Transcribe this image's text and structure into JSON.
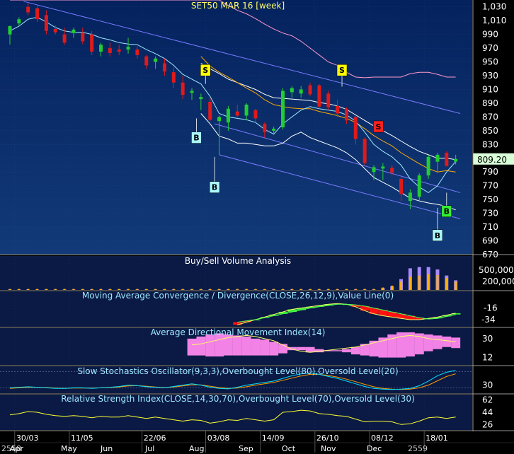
{
  "colors": {
    "bg_top": "#062a6a",
    "bg_bottom": "#0d2f66",
    "panel_bg": "#0a1a44",
    "grid": "#4a5a8a",
    "up": "#22cc33",
    "down": "#e01a1a",
    "ema_fast": "#ffffff",
    "ema_mid": "#ffaa00",
    "ema_slow": "#ff99cc",
    "channel": "#7b7bff",
    "macd_line": "#ffff66",
    "macd_hist_pos": "#33ee33",
    "macd_hist_neg": "#ff1111",
    "adx_fill": "#ff88ee",
    "stoch_k": "#00e0ff",
    "stoch_d": "#ff9900",
    "rsi": "#ffff33"
  },
  "chart_data": [
    {
      "type": "candlestick",
      "title": "SET50 MAR 16  [week]",
      "ylim": [
        670,
        1040
      ],
      "y_ticks": [
        1030,
        1010,
        990,
        970,
        950,
        930,
        910,
        890,
        870,
        850,
        830,
        810,
        790,
        770,
        750,
        730,
        710,
        690,
        670
      ],
      "last_price": "809.20",
      "x_date_labels": [
        "30/03",
        "11/05",
        "22/06",
        "03/08",
        "14/09",
        "26/10",
        "08/12",
        "18/01"
      ],
      "x_month_labels": [
        "2558",
        "Apr",
        "May",
        "Jun",
        "Jul",
        "Aug",
        "Sep",
        "Oct",
        "Nov",
        "Dec",
        "2559"
      ],
      "candles": [
        {
          "o": 990,
          "h": 1003,
          "l": 975,
          "c": 1002
        },
        {
          "o": 1006,
          "h": 1015,
          "l": 1002,
          "c": 1012
        },
        {
          "o": 1030,
          "h": 1035,
          "l": 1018,
          "c": 1022
        },
        {
          "o": 1028,
          "h": 1033,
          "l": 1008,
          "c": 1012
        },
        {
          "o": 1018,
          "h": 1025,
          "l": 990,
          "c": 995
        },
        {
          "o": 998,
          "h": 1003,
          "l": 990,
          "c": 993
        },
        {
          "o": 990,
          "h": 1000,
          "l": 975,
          "c": 978
        },
        {
          "o": 992,
          "h": 1000,
          "l": 985,
          "c": 997
        },
        {
          "o": 992,
          "h": 1000,
          "l": 976,
          "c": 980
        },
        {
          "o": 990,
          "h": 995,
          "l": 960,
          "c": 965
        },
        {
          "o": 965,
          "h": 978,
          "l": 958,
          "c": 975
        },
        {
          "o": 970,
          "h": 978,
          "l": 958,
          "c": 963
        },
        {
          "o": 968,
          "h": 975,
          "l": 960,
          "c": 965
        },
        {
          "o": 968,
          "h": 985,
          "l": 962,
          "c": 972
        },
        {
          "o": 968,
          "h": 972,
          "l": 955,
          "c": 960
        },
        {
          "o": 958,
          "h": 960,
          "l": 940,
          "c": 945
        },
        {
          "o": 950,
          "h": 958,
          "l": 940,
          "c": 955
        },
        {
          "o": 948,
          "h": 955,
          "l": 930,
          "c": 936
        },
        {
          "o": 935,
          "h": 942,
          "l": 912,
          "c": 920
        },
        {
          "o": 920,
          "h": 930,
          "l": 896,
          "c": 902
        },
        {
          "o": 905,
          "h": 912,
          "l": 895,
          "c": 908
        },
        {
          "o": 896,
          "h": 904,
          "l": 880,
          "c": 899
        },
        {
          "o": 892,
          "h": 898,
          "l": 864,
          "c": 866
        },
        {
          "o": 864,
          "h": 872,
          "l": 815,
          "c": 870
        },
        {
          "o": 862,
          "h": 886,
          "l": 850,
          "c": 882
        },
        {
          "o": 878,
          "h": 888,
          "l": 870,
          "c": 872
        },
        {
          "o": 872,
          "h": 890,
          "l": 865,
          "c": 888
        },
        {
          "o": 880,
          "h": 882,
          "l": 862,
          "c": 868
        },
        {
          "o": 860,
          "h": 862,
          "l": 840,
          "c": 848
        },
        {
          "o": 850,
          "h": 856,
          "l": 844,
          "c": 853
        },
        {
          "o": 855,
          "h": 912,
          "l": 852,
          "c": 908
        },
        {
          "o": 906,
          "h": 915,
          "l": 898,
          "c": 912
        },
        {
          "o": 904,
          "h": 915,
          "l": 898,
          "c": 910
        },
        {
          "o": 916,
          "h": 920,
          "l": 900,
          "c": 903
        },
        {
          "o": 916,
          "h": 918,
          "l": 882,
          "c": 885
        },
        {
          "o": 904,
          "h": 908,
          "l": 880,
          "c": 884
        },
        {
          "o": 886,
          "h": 895,
          "l": 870,
          "c": 875
        },
        {
          "o": 882,
          "h": 884,
          "l": 860,
          "c": 865
        },
        {
          "o": 870,
          "h": 872,
          "l": 830,
          "c": 838
        },
        {
          "o": 838,
          "h": 840,
          "l": 800,
          "c": 803
        },
        {
          "o": 790,
          "h": 800,
          "l": 778,
          "c": 797
        },
        {
          "o": 795,
          "h": 803,
          "l": 778,
          "c": 798
        },
        {
          "o": 796,
          "h": 800,
          "l": 785,
          "c": 789
        },
        {
          "o": 780,
          "h": 783,
          "l": 748,
          "c": 758
        },
        {
          "o": 748,
          "h": 765,
          "l": 736,
          "c": 760
        },
        {
          "o": 754,
          "h": 788,
          "l": 748,
          "c": 785
        },
        {
          "o": 785,
          "h": 815,
          "l": 780,
          "c": 812
        },
        {
          "o": 805,
          "h": 818,
          "l": 790,
          "c": 815
        },
        {
          "o": 818,
          "h": 820,
          "l": 798,
          "c": 799
        },
        {
          "o": 805,
          "h": 815,
          "l": 801,
          "c": 809
        }
      ],
      "indicators": {
        "ema_fast": [
          995,
          1002,
          1012,
          1015,
          1008,
          1000,
          995,
          993,
          993,
          990,
          985,
          982,
          978,
          976,
          975,
          968,
          962,
          955,
          945,
          932,
          925,
          918,
          900,
          875,
          870,
          868,
          866,
          862,
          852,
          845,
          860,
          870,
          880,
          885,
          882,
          880,
          878,
          873,
          864,
          848,
          830,
          820,
          812,
          800,
          780,
          768,
          760,
          770,
          790,
          805
        ],
        "ema_mid": [
          null,
          null,
          null,
          null,
          null,
          null,
          null,
          null,
          null,
          null,
          null,
          null,
          null,
          null,
          null,
          null,
          null,
          null,
          null,
          null,
          null,
          958,
          944,
          935,
          928,
          920,
          912,
          905,
          895,
          888,
          885,
          883,
          882,
          882,
          878,
          875,
          872,
          868,
          862,
          853,
          843,
          835,
          828,
          818,
          810,
          802,
          795,
          790,
          792,
          790
        ],
        "ema_slow": [
          null,
          null,
          null,
          null,
          null,
          null,
          null,
          null,
          null,
          null,
          null,
          null,
          null,
          null,
          null,
          null,
          null,
          null,
          null,
          null,
          null,
          948,
          940,
          933,
          925,
          920,
          915,
          910,
          903,
          898,
          897,
          896,
          895,
          894,
          891,
          889,
          886,
          881,
          873,
          865,
          857,
          850,
          843,
          835,
          827,
          820,
          815,
          810,
          810,
          808
        ],
        "bb_upper": [
          1040,
          1040,
          1040,
          1040,
          1040,
          1040,
          1040,
          1040,
          1040,
          1040,
          1040,
          1040,
          1040,
          1040,
          1040,
          1040,
          1040,
          1040,
          1040,
          1040,
          1040,
          1040,
          1040,
          1040,
          1032,
          1025,
          1020,
          1013,
          1005,
          998,
          992,
          988,
          980,
          970,
          960,
          950,
          945,
          935,
          928,
          927,
          928,
          928,
          928,
          928,
          933,
          935,
          935,
          932,
          928,
          928
        ],
        "bb_lower": [
          null,
          null,
          null,
          null,
          null,
          null,
          null,
          null,
          null,
          null,
          null,
          null,
          null,
          null,
          null,
          null,
          null,
          null,
          null,
          null,
          null,
          875,
          860,
          842,
          838,
          832,
          832,
          830,
          828,
          828,
          832,
          842,
          848,
          840,
          835,
          830,
          825,
          818,
          808,
          795,
          782,
          775,
          768,
          760,
          752,
          748,
          745,
          743,
          740,
          735
        ]
      },
      "channel_lines": [
        {
          "name": "upper",
          "from": {
            "i": 1.5,
            "v": 1038
          },
          "to": {
            "i": 49.5,
            "v": 875
          }
        },
        {
          "name": "mid",
          "from": {
            "i": 22.5,
            "v": 860
          },
          "to": {
            "i": 49.5,
            "v": 760
          }
        },
        {
          "name": "lower",
          "from": {
            "i": 23.0,
            "v": 815
          },
          "to": {
            "i": 49.5,
            "v": 722
          }
        }
      ],
      "signals": [
        {
          "label": "S",
          "i": 21.5,
          "v": 938,
          "color": "#ffff00",
          "text_color": "#000000"
        },
        {
          "label": "S",
          "i": 36.5,
          "v": 938,
          "color": "#ffff00",
          "text_color": "#000000"
        },
        {
          "label": "S",
          "i": 40.5,
          "v": 856,
          "color": "#ff2020",
          "text_color": "#000000"
        },
        {
          "label": "B",
          "i": 20.5,
          "v": 840,
          "color": "#aaf8ff",
          "text_color": "#000000"
        },
        {
          "label": "B",
          "i": 22.5,
          "v": 768,
          "color": "#aaf8ff",
          "text_color": "#000000"
        },
        {
          "label": "B",
          "i": 48.0,
          "v": 733,
          "color": "#33ee33",
          "text_color": "#000000"
        },
        {
          "label": "B",
          "i": 47.0,
          "v": 698,
          "color": "#aaf8ff",
          "text_color": "#000000"
        }
      ]
    },
    {
      "type": "bar",
      "title": "Buy/Sell Volume Analysis",
      "y_ticks": [
        "500,000",
        "200,000"
      ],
      "note": "volume bars mostly near zero until the last eight weeks",
      "buy": [
        0.04,
        0.04,
        0.04,
        0.04,
        0.04,
        0.04,
        0.04,
        0.04,
        0.04,
        0.04,
        0.04,
        0.04,
        0.04,
        0.04,
        0.04,
        0.04,
        0.04,
        0.04,
        0.04,
        0.04,
        0.04,
        0.04,
        0.04,
        0.04,
        0.04,
        0.04,
        0.04,
        0.04,
        0.04,
        0.04,
        0.04,
        0.04,
        0.04,
        0.04,
        0.04,
        0.04,
        0.04,
        0.04,
        0.04,
        0.04,
        0.04,
        0.1,
        0.18,
        0.35,
        0.55,
        0.6,
        0.65,
        0.62,
        0.5,
        0.35
      ],
      "sell": [
        0.02,
        0.02,
        0.02,
        0.02,
        0.02,
        0.02,
        0.02,
        0.02,
        0.02,
        0.02,
        0.02,
        0.02,
        0.02,
        0.02,
        0.02,
        0.02,
        0.02,
        0.02,
        0.02,
        0.02,
        0.02,
        0.02,
        0.02,
        0.02,
        0.02,
        0.02,
        0.02,
        0.02,
        0.02,
        0.02,
        0.02,
        0.02,
        0.02,
        0.02,
        0.02,
        0.02,
        0.02,
        0.02,
        0.02,
        0.02,
        0.02,
        0.08,
        0.15,
        0.45,
        0.9,
        0.95,
        0.95,
        0.85,
        0.6,
        0.4
      ]
    },
    {
      "type": "line",
      "title": "Moving Average Convergence / Divergence(CLOSE,26,12,9),Value Line(0)",
      "y_ticks": [
        "-16",
        "-34"
      ],
      "ylim": [
        -45,
        10
      ],
      "macd": [
        null,
        null,
        null,
        null,
        null,
        null,
        null,
        null,
        null,
        null,
        null,
        null,
        null,
        null,
        null,
        null,
        null,
        null,
        null,
        null,
        null,
        null,
        null,
        null,
        null,
        -42,
        -38,
        -34,
        -30,
        -26,
        -22,
        -18,
        -16,
        -14,
        -12,
        -10,
        -9,
        -10,
        -14,
        -20,
        -25,
        -28,
        -30,
        -32,
        -34,
        -34,
        -32,
        -30,
        -27,
        -24
      ],
      "signal": [
        null,
        null,
        null,
        null,
        null,
        null,
        null,
        null,
        null,
        null,
        null,
        null,
        null,
        null,
        null,
        null,
        null,
        null,
        null,
        null,
        null,
        null,
        null,
        null,
        null,
        -38,
        -36,
        -34,
        -31,
        -28,
        -25,
        -22,
        -19,
        -16,
        -14,
        -12,
        -10,
        -10,
        -11,
        -13,
        -16,
        -19,
        -22,
        -25,
        -28,
        -31,
        -33,
        -32,
        -29,
        -26
      ]
    },
    {
      "type": "area",
      "title": "Average Directional Movement Index(14)",
      "y_ticks": [
        "30",
        "12"
      ],
      "ylim": [
        5,
        40
      ],
      "adx": [
        null,
        null,
        null,
        null,
        null,
        null,
        null,
        null,
        null,
        null,
        null,
        null,
        null,
        null,
        null,
        null,
        null,
        null,
        null,
        null,
        24,
        25,
        27,
        29,
        31,
        32,
        33,
        32,
        30,
        28,
        24,
        20,
        18,
        17,
        18,
        19,
        20,
        21,
        22,
        24,
        26,
        28,
        30,
        32,
        33,
        32,
        30,
        29,
        28,
        27
      ],
      "di_plus": [
        null,
        null,
        null,
        null,
        null,
        null,
        null,
        null,
        null,
        null,
        null,
        null,
        null,
        null,
        null,
        null,
        null,
        null,
        null,
        null,
        14,
        14,
        13,
        13,
        14,
        14,
        14,
        14,
        14,
        14,
        16,
        19,
        22,
        22,
        20,
        19,
        18,
        17,
        15,
        14,
        13,
        12,
        12,
        12,
        13,
        15,
        18,
        20,
        22,
        21
      ],
      "di_minus": [
        null,
        null,
        null,
        null,
        null,
        null,
        null,
        null,
        null,
        null,
        null,
        null,
        null,
        null,
        null,
        null,
        null,
        null,
        null,
        null,
        30,
        32,
        34,
        35,
        34,
        33,
        32,
        30,
        29,
        27,
        25,
        22,
        19,
        17,
        17,
        18,
        19,
        20,
        22,
        25,
        28,
        31,
        34,
        36,
        36,
        35,
        34,
        33,
        32,
        31
      ]
    },
    {
      "type": "line",
      "title": "Slow Stochastics Oscillator(9,3,3),Overbought Level(80),Oversold Level(20)",
      "y_ticks": [
        "30"
      ],
      "ylim": [
        0,
        100
      ],
      "k": [
        20,
        22,
        24,
        22,
        20,
        18,
        18,
        20,
        20,
        18,
        20,
        22,
        25,
        30,
        28,
        24,
        22,
        20,
        25,
        30,
        35,
        30,
        22,
        18,
        16,
        22,
        30,
        35,
        40,
        45,
        55,
        65,
        72,
        75,
        70,
        62,
        55,
        45,
        35,
        25,
        18,
        15,
        14,
        15,
        18,
        28,
        45,
        65,
        78,
        85
      ],
      "d": [
        18,
        20,
        22,
        22,
        21,
        19,
        18,
        19,
        19,
        19,
        20,
        21,
        23,
        27,
        28,
        26,
        23,
        21,
        23,
        27,
        31,
        31,
        26,
        21,
        18,
        19,
        24,
        30,
        35,
        40,
        48,
        56,
        64,
        70,
        70,
        66,
        60,
        52,
        43,
        33,
        24,
        18,
        15,
        14,
        15,
        20,
        30,
        46,
        62,
        72
      ]
    },
    {
      "type": "line",
      "title": "Relative Strength Index(CLOSE,14,30,70),Overbought Level(70),Oversold Level(30)",
      "y_ticks": [
        "62",
        "44",
        "26"
      ],
      "ylim": [
        18,
        70
      ],
      "rsi": [
        40,
        42,
        45,
        44,
        41,
        39,
        38,
        39,
        38,
        36,
        38,
        37,
        37,
        39,
        37,
        35,
        37,
        35,
        33,
        31,
        33,
        32,
        28,
        30,
        33,
        32,
        35,
        33,
        31,
        33,
        44,
        45,
        47,
        46,
        42,
        41,
        39,
        38,
        34,
        30,
        31,
        31,
        30,
        26,
        27,
        31,
        36,
        37,
        35,
        37
      ]
    }
  ]
}
